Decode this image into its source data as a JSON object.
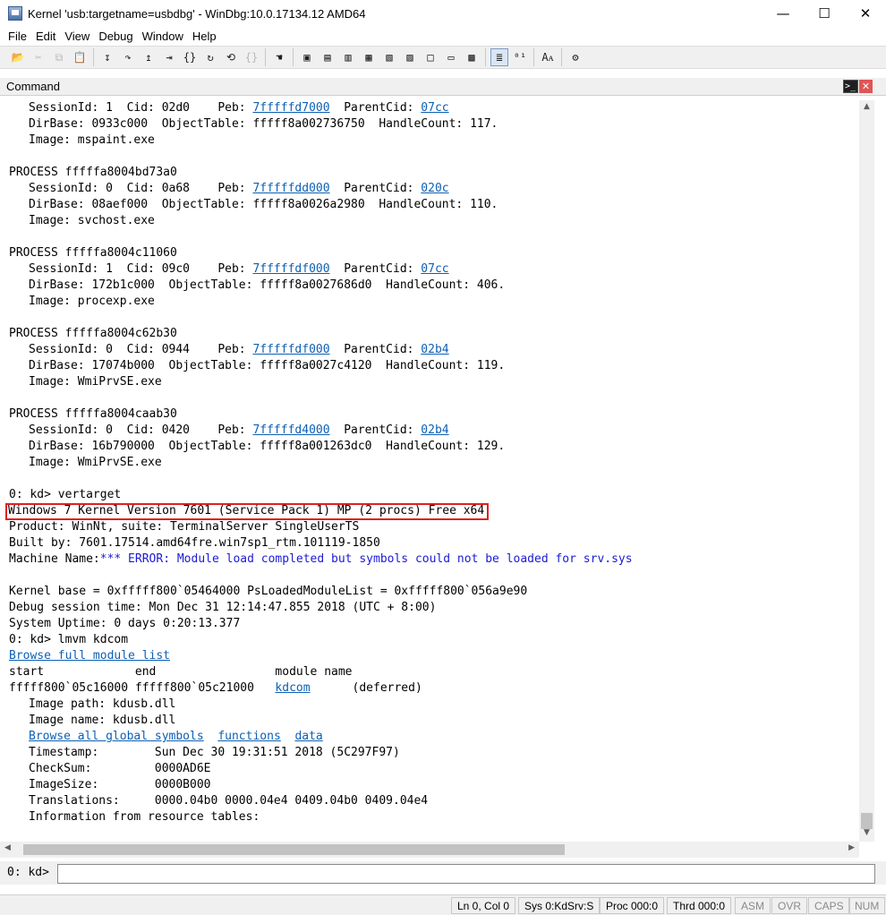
{
  "window": {
    "title": "Kernel 'usb:targetname=usbdbg' - WinDbg:10.0.17134.12 AMD64",
    "minimize": "—",
    "maximize": "☐",
    "close": "✕"
  },
  "menu": [
    "File",
    "Edit",
    "View",
    "Debug",
    "Window",
    "Help"
  ],
  "toolbar_icons": [
    {
      "name": "open-icon",
      "glyph": "📂",
      "enabled": true
    },
    {
      "name": "cut-icon",
      "glyph": "✂",
      "enabled": false
    },
    {
      "name": "copy-icon",
      "glyph": "⧉",
      "enabled": false
    },
    {
      "name": "paste-icon",
      "glyph": "📋",
      "enabled": true
    },
    {
      "name": "step-into-icon",
      "glyph": "↧",
      "enabled": true
    },
    {
      "name": "step-over-icon",
      "glyph": "↷",
      "enabled": true
    },
    {
      "name": "step-out-icon",
      "glyph": "↥",
      "enabled": true
    },
    {
      "name": "run-to-cursor-icon",
      "glyph": "⇥",
      "enabled": true
    },
    {
      "name": "source-step-icon",
      "glyph": "{}",
      "enabled": true
    },
    {
      "name": "go-icon",
      "glyph": "↻",
      "enabled": true
    },
    {
      "name": "restart-icon",
      "glyph": "⟲",
      "enabled": true
    },
    {
      "name": "breakpoint-icon",
      "glyph": "{}",
      "enabled": false
    },
    {
      "name": "hand-icon",
      "glyph": "☚",
      "enabled": true
    },
    {
      "name": "command-window-icon",
      "glyph": "▣",
      "enabled": true
    },
    {
      "name": "watch-window-icon",
      "glyph": "▤",
      "enabled": true
    },
    {
      "name": "locals-window-icon",
      "glyph": "▥",
      "enabled": true
    },
    {
      "name": "registers-window-icon",
      "glyph": "▦",
      "enabled": true
    },
    {
      "name": "memory-window-icon",
      "glyph": "▧",
      "enabled": true
    },
    {
      "name": "call-stack-icon",
      "glyph": "▨",
      "enabled": true
    },
    {
      "name": "disassembly-icon",
      "glyph": "□",
      "enabled": true
    },
    {
      "name": "scratch-pad-icon",
      "glyph": "▭",
      "enabled": true
    },
    {
      "name": "process-thread-icon",
      "glyph": "▩",
      "enabled": true
    },
    {
      "name": "source-mode-icon",
      "glyph": "≣",
      "enabled": true,
      "active": true
    },
    {
      "name": "hex-icon",
      "glyph": "⁰¹",
      "enabled": true
    },
    {
      "name": "font-icon",
      "glyph": "Aᴀ",
      "enabled": true
    },
    {
      "name": "options-icon",
      "glyph": "⚙",
      "enabled": true
    }
  ],
  "command_window": {
    "title": "Command",
    "icon_glyph": ">_",
    "close": "✕"
  },
  "output_lines": [
    {
      "indent": true,
      "parts": [
        {
          "t": "SessionId: 1  Cid: 02d0    Peb: "
        },
        {
          "t": "7fffffd7000",
          "link": true
        },
        {
          "t": "  ParentCid: "
        },
        {
          "t": "07cc",
          "link": true
        }
      ]
    },
    {
      "indent": true,
      "parts": [
        {
          "t": "DirBase: 0933c000  ObjectTable: fffff8a002736750  HandleCount: 117."
        }
      ]
    },
    {
      "indent": true,
      "parts": [
        {
          "t": "Image: mspaint.exe"
        }
      ]
    },
    {
      "parts": [
        {
          "t": ""
        }
      ]
    },
    {
      "parts": [
        {
          "t": "PROCESS fffffa8004bd73a0"
        }
      ]
    },
    {
      "indent": true,
      "parts": [
        {
          "t": "SessionId: 0  Cid: 0a68    Peb: "
        },
        {
          "t": "7fffffdd000",
          "link": true
        },
        {
          "t": "  ParentCid: "
        },
        {
          "t": "020c",
          "link": true
        }
      ]
    },
    {
      "indent": true,
      "parts": [
        {
          "t": "DirBase: 08aef000  ObjectTable: fffff8a0026a2980  HandleCount: 110."
        }
      ]
    },
    {
      "indent": true,
      "parts": [
        {
          "t": "Image: svchost.exe"
        }
      ]
    },
    {
      "parts": [
        {
          "t": ""
        }
      ]
    },
    {
      "parts": [
        {
          "t": "PROCESS fffffa8004c11060"
        }
      ]
    },
    {
      "indent": true,
      "parts": [
        {
          "t": "SessionId: 1  Cid: 09c0    Peb: "
        },
        {
          "t": "7fffffdf000",
          "link": true
        },
        {
          "t": "  ParentCid: "
        },
        {
          "t": "07cc",
          "link": true
        }
      ]
    },
    {
      "indent": true,
      "parts": [
        {
          "t": "DirBase: 172b1c000  ObjectTable: fffff8a0027686d0  HandleCount: 406."
        }
      ]
    },
    {
      "indent": true,
      "parts": [
        {
          "t": "Image: procexp.exe"
        }
      ]
    },
    {
      "parts": [
        {
          "t": ""
        }
      ]
    },
    {
      "parts": [
        {
          "t": "PROCESS fffffa8004c62b30"
        }
      ]
    },
    {
      "indent": true,
      "parts": [
        {
          "t": "SessionId: 0  Cid: 0944    Peb: "
        },
        {
          "t": "7fffffdf000",
          "link": true
        },
        {
          "t": "  ParentCid: "
        },
        {
          "t": "02b4",
          "link": true
        }
      ]
    },
    {
      "indent": true,
      "parts": [
        {
          "t": "DirBase: 17074b000  ObjectTable: fffff8a0027c4120  HandleCount: 119."
        }
      ]
    },
    {
      "indent": true,
      "parts": [
        {
          "t": "Image: WmiPrvSE.exe"
        }
      ]
    },
    {
      "parts": [
        {
          "t": ""
        }
      ]
    },
    {
      "parts": [
        {
          "t": "PROCESS fffffa8004caab30"
        }
      ]
    },
    {
      "indent": true,
      "parts": [
        {
          "t": "SessionId: 0  Cid: 0420    Peb: "
        },
        {
          "t": "7fffffd4000",
          "link": true
        },
        {
          "t": "  ParentCid: "
        },
        {
          "t": "02b4",
          "link": true
        }
      ]
    },
    {
      "indent": true,
      "parts": [
        {
          "t": "DirBase: 16b790000  ObjectTable: fffff8a001263dc0  HandleCount: 129."
        }
      ]
    },
    {
      "indent": true,
      "parts": [
        {
          "t": "Image: WmiPrvSE.exe"
        }
      ]
    },
    {
      "parts": [
        {
          "t": ""
        }
      ]
    },
    {
      "parts": [
        {
          "t": "0: kd> vertarget"
        }
      ]
    },
    {
      "highlight": true,
      "parts": [
        {
          "t": "Windows 7 Kernel Version 7601 (Service Pack 1) MP (2 procs) Free x64"
        }
      ]
    },
    {
      "parts": [
        {
          "t": "Product: WinNt, suite: TerminalServer SingleUserTS"
        }
      ]
    },
    {
      "parts": [
        {
          "t": "Built by: 7601.17514.amd64fre.win7sp1_rtm.101119-1850"
        }
      ]
    },
    {
      "parts": [
        {
          "t": "Machine Name:"
        },
        {
          "t": "*** ERROR: Module load completed but symbols could not be loaded for srv.sys",
          "blue": true
        }
      ]
    },
    {
      "parts": [
        {
          "t": ""
        }
      ]
    },
    {
      "parts": [
        {
          "t": "Kernel base = 0xfffff800`05464000 PsLoadedModuleList = 0xfffff800`056a9e90"
        }
      ]
    },
    {
      "parts": [
        {
          "t": "Debug session time: Mon Dec 31 12:14:47.855 2018 (UTC + 8:00)"
        }
      ]
    },
    {
      "parts": [
        {
          "t": "System Uptime: 0 days 0:20:13.377"
        }
      ]
    },
    {
      "parts": [
        {
          "t": "0: kd> lmvm kdcom"
        }
      ]
    },
    {
      "parts": [
        {
          "t": "Browse full module list",
          "link": true
        }
      ]
    },
    {
      "parts": [
        {
          "t": "start             end                 module name"
        }
      ]
    },
    {
      "parts": [
        {
          "t": "fffff800`05c16000 fffff800`05c21000   "
        },
        {
          "t": "kdcom",
          "link": true
        },
        {
          "t": "      (deferred)"
        }
      ]
    },
    {
      "indent": true,
      "parts": [
        {
          "t": "Image path: kdusb.dll"
        }
      ]
    },
    {
      "indent": true,
      "parts": [
        {
          "t": "Image name: kdusb.dll"
        }
      ]
    },
    {
      "indent": true,
      "parts": [
        {
          "t": "Browse all global symbols",
          "link": true
        },
        {
          "t": "  "
        },
        {
          "t": "functions",
          "link": true
        },
        {
          "t": "  "
        },
        {
          "t": "data",
          "link": true
        }
      ]
    },
    {
      "indent": true,
      "parts": [
        {
          "t": "Timestamp:        Sun Dec 30 19:31:51 2018 (5C297F97)"
        }
      ]
    },
    {
      "indent": true,
      "parts": [
        {
          "t": "CheckSum:         0000AD6E"
        }
      ]
    },
    {
      "indent": true,
      "parts": [
        {
          "t": "ImageSize:        0000B000"
        }
      ]
    },
    {
      "indent": true,
      "parts": [
        {
          "t": "Translations:     0000.04b0 0000.04e4 0409.04b0 0409.04e4"
        }
      ]
    },
    {
      "indent": true,
      "parts": [
        {
          "t": "Information from resource tables:"
        }
      ]
    }
  ],
  "prompt": {
    "label": "0: kd>",
    "value": ""
  },
  "status": {
    "ln_col": "Ln 0, Col 0",
    "sys": "Sys 0:KdSrv:S",
    "proc": "Proc 000:0",
    "thrd": "Thrd 000:0",
    "asm": "ASM",
    "ovr": "OVR",
    "caps": "CAPS",
    "num": "NUM"
  },
  "scroll_arrows": {
    "up": "▲",
    "down": "▼",
    "left": "◀",
    "right": "▶"
  }
}
